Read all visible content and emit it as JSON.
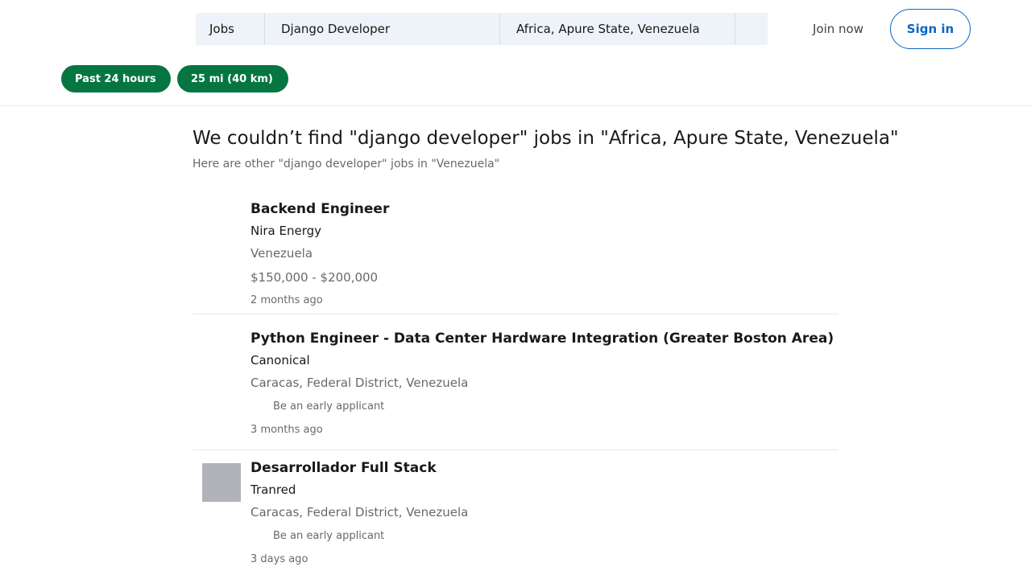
{
  "search": {
    "type_label": "Jobs",
    "keyword": "Django Developer",
    "location": "Africa, Apure State, Venezuela"
  },
  "nav": {
    "join_label": "Join now",
    "signin_label": "Sign in"
  },
  "filters": [
    {
      "label": "Past 24 hours"
    },
    {
      "label": "25 mi (40 km)"
    }
  ],
  "results": {
    "headline": "We couldn’t find \"django developer\" jobs in \"Africa, Apure State, Venezuela\"",
    "subline": "Here are other \"django developer\" jobs in \"Venezuela\""
  },
  "jobs": [
    {
      "title": "Backend Engineer",
      "company": "Nira Energy",
      "location": "Venezuela",
      "salary": "$150,000 - $200,000",
      "posted": "2 months ago"
    },
    {
      "title": "Python Engineer - Data Center Hardware Integration (Greater Boston Area)",
      "company": "Canonical",
      "location": "Caracas, Federal District, Venezuela",
      "insight": "Be an early applicant",
      "posted": "3 months ago"
    },
    {
      "title": "Desarrollador Full Stack",
      "company": "Tranred",
      "location": "Caracas, Federal District, Venezuela",
      "insight": "Be an early applicant",
      "posted": "3 days ago"
    }
  ],
  "colors": {
    "accent": "#0a66c2",
    "filter_pill": "#057642",
    "search_bg": "#edf3f8",
    "logo_placeholder": "#b0b3b7"
  }
}
